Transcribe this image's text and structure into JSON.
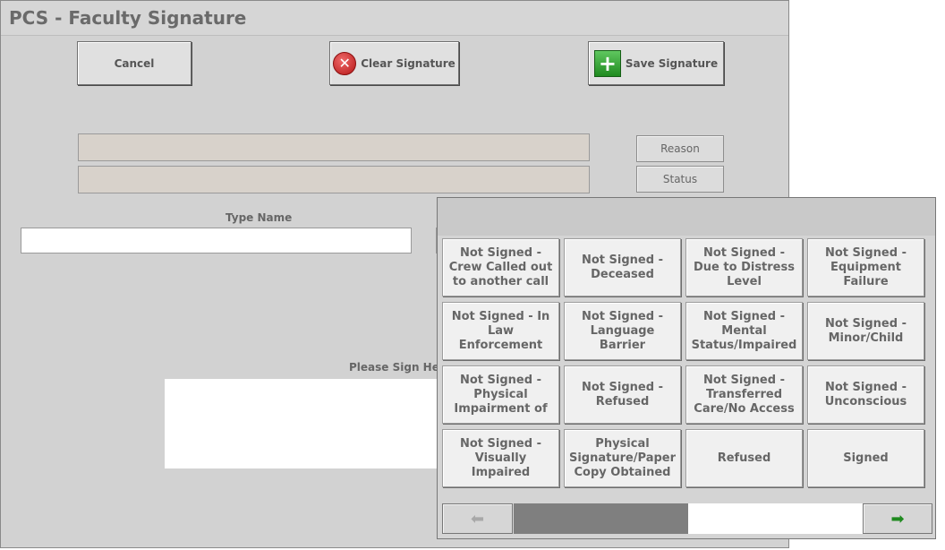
{
  "window": {
    "title": "PCS - Faculty Signature"
  },
  "toolbar": {
    "cancel_label": "Cancel",
    "clear_label": "Clear Signature",
    "save_label": "Save Signature"
  },
  "fields": {
    "reason_button": "Reason",
    "status_button": "Status",
    "reason_value": "",
    "status_value": "",
    "type_name_label": "Type Name",
    "type_name_value": "",
    "sign_here_label": "Please Sign Her"
  },
  "icons": {
    "clear": "clear-x-icon",
    "save": "save-plus-icon",
    "prev": "arrow-left-icon",
    "next": "arrow-right-icon"
  },
  "colors": {
    "clear_icon": "#c41e1e",
    "save_icon": "#2ea52e",
    "next_arrow": "#1f8a1f"
  },
  "popup": {
    "options": [
      "Not Signed - Crew Called out to another call",
      "Not Signed - Deceased",
      "Not Signed - Due to Distress Level",
      "Not Signed - Equipment Failure",
      "Not Signed - In Law Enforcement",
      "Not Signed - Language Barrier",
      "Not Signed - Mental Status/Impaired",
      "Not Signed - Minor/Child",
      "Not Signed - Physical Impairment of",
      "Not Signed - Refused",
      "Not Signed - Transferred Care/No Access",
      "Not Signed - Unconscious",
      "Not Signed -Visually Impaired",
      "Physical Signature/Paper Copy Obtained",
      "Refused",
      "Signed"
    ],
    "page_progress": 0.5
  }
}
